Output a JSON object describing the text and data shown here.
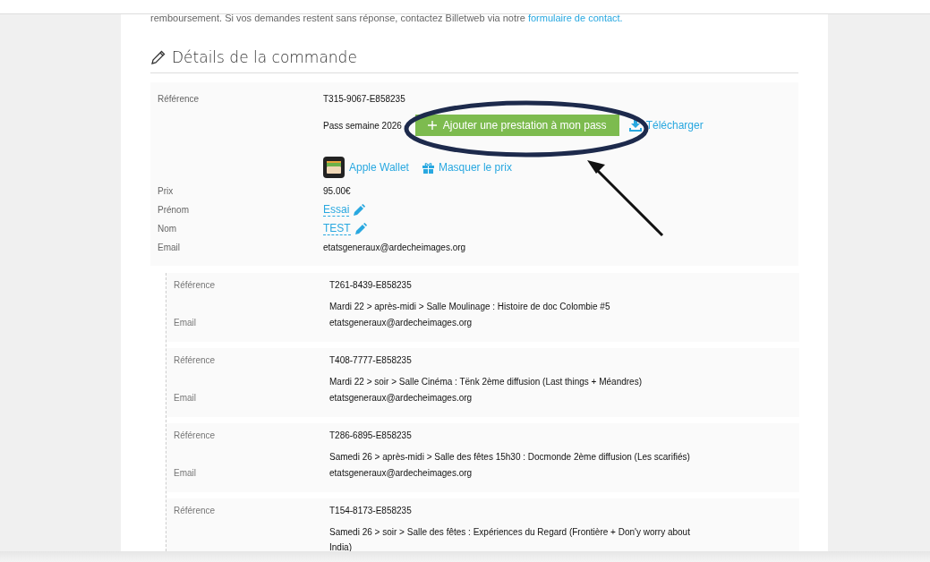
{
  "notice": {
    "text": "remboursement. Si vos demandes restent sans réponse, contactez Billetweb via notre",
    "link": "formulaire de contact."
  },
  "section": {
    "title": "Détails de la commande"
  },
  "order": {
    "reference_label": "Référence",
    "reference": "T315-9067-E858235",
    "pass_name": "Pass semaine 2026",
    "add_button": "Ajouter une prestation à mon pass",
    "download": "Télécharger",
    "wallet": "Apple Wallet",
    "hide_price": "Masquer le prix",
    "fields": [
      {
        "label": "Prix",
        "value": "95.00€",
        "editable": false
      },
      {
        "label": "Prénom",
        "value": "Essai",
        "editable": true
      },
      {
        "label": "Nom",
        "value": "TEST",
        "editable": true
      },
      {
        "label": "Email",
        "value": "etatsgeneraux@ardecheimages.org",
        "editable": false
      }
    ]
  },
  "tickets": [
    {
      "reference_label": "Référence",
      "reference": "T261-8439-E858235",
      "event": "Mardi 22 > après-midi > Salle Moulinage : Histoire de doc Colombie #5",
      "email_label": "Email",
      "email": "etatsgeneraux@ardecheimages.org"
    },
    {
      "reference_label": "Référence",
      "reference": "T408-7777-E858235",
      "event": "Mardi 22 > soir > Salle Cinéma : Tënk 2ème diffusion (Last things + Méandres)",
      "email_label": "Email",
      "email": "etatsgeneraux@ardecheimages.org"
    },
    {
      "reference_label": "Référence",
      "reference": "T286-6895-E858235",
      "event": "Samedi 26 > après-midi > Salle des fêtes 15h30 : Docmonde 2ème diffusion (Les scarifiés)",
      "email_label": "Email",
      "email": "etatsgeneraux@ardecheimages.org"
    },
    {
      "reference_label": "Référence",
      "reference": "T154-8173-E858235",
      "event": "Samedi 26 > soir > Salle des fêtes : Expériences du Regard (Frontière + Don'y worry about India)"
    }
  ]
}
